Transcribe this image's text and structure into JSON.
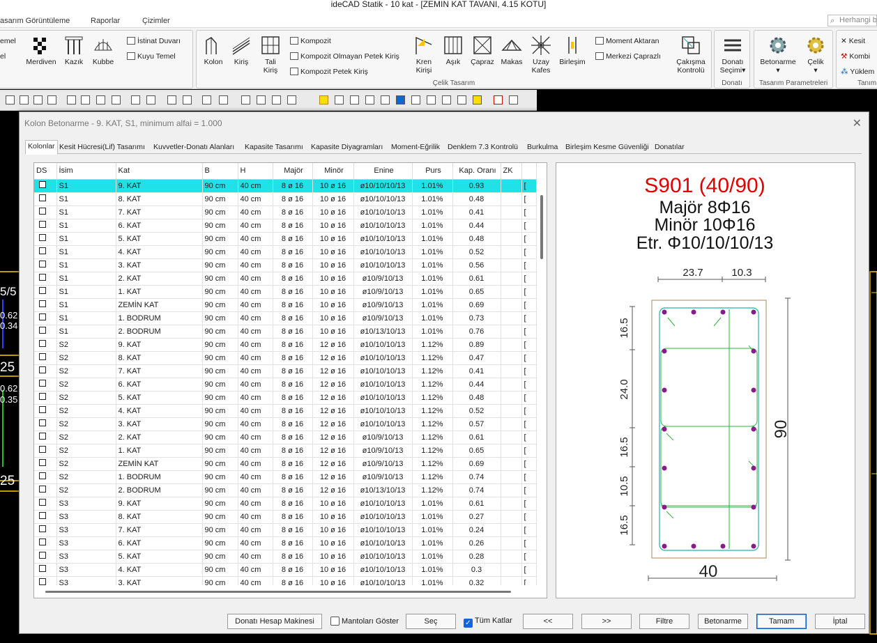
{
  "window_title": "ideCAD Statik - 10 kat - [ZEMIN KAT TAVANI,  4.15 KOTU]",
  "menu": [
    "asarım Görüntüleme",
    "Raporlar",
    "Çizimler"
  ],
  "search_placeholder": "Herhangi b",
  "ribbon": {
    "left_items": [
      "emel",
      "el"
    ],
    "merdiven": "Merdiven",
    "kazik": "Kazık",
    "kubbe": "Kubbe",
    "istinat": "İstinat Duvarı",
    "kuyu": "Kuyu Temel",
    "kolon": "Kolon",
    "kiris": "Kiriş",
    "tali1": "Tali",
    "tali2": "Kiriş",
    "kompozit": "Kompozit",
    "kompozit_olmayan": "Kompozit Olmayan Petek Kiriş",
    "kompozit_petek": "Kompozit Petek Kiriş",
    "kren1": "Kren",
    "kren2": "Kirişi",
    "asik": "Aşık",
    "capraz": "Çapraz",
    "makas": "Makas",
    "uzay1": "Uzay",
    "uzay2": "Kafes",
    "birlesim": "Birleşim",
    "moment": "Moment Aktaran",
    "merkezi": "Merkezi Çaprazlı",
    "cakisma1": "Çakışma",
    "cakisma2": "Kontrolü",
    "celik_tasarim": "Çelik Tasarım",
    "donati_sec1": "Donatı",
    "donati_sec2": "Seçimi",
    "donati": "Donatı",
    "betonarme": "Betonarme",
    "celik": "Çelik",
    "tasarim_param": "Tasarım Parametreleri",
    "kesit": "Kesit",
    "kombi": "Kombi",
    "yuklem": "Yüklem",
    "tanim": "Tanım"
  },
  "dialog": {
    "title": "Kolon Betonarme - 9. KAT, S1, minimum alfai = 1.000",
    "tabs": [
      "Kolonlar",
      "Kesit Hücresi(Lif) Tasarımı",
      "Kuvvetler-Donatı Alanları",
      "Kapasite Tasarımı",
      "Kapasite Diyagramları",
      "Moment-Eğrilik",
      "Denklem 7.3 Kontrolü",
      "Burkulma",
      "Birleşim Kesme Güvenliği",
      "Donatılar"
    ],
    "columns": [
      "DS",
      "İsim",
      "Kat",
      "B",
      "H",
      "Majör",
      "Minör",
      "Enine",
      "Purs",
      "Kap. Oranı",
      "ZK"
    ],
    "rows": [
      [
        "S1",
        "9. KAT",
        "90 cm",
        "40 cm",
        "8 ø 16",
        "10 ø 16",
        "ø10/10/10/13",
        "1.01%",
        "0.93"
      ],
      [
        "S1",
        "8. KAT",
        "90 cm",
        "40 cm",
        "8 ø 16",
        "10 ø 16",
        "ø10/10/10/13",
        "1.01%",
        "0.48"
      ],
      [
        "S1",
        "7. KAT",
        "90 cm",
        "40 cm",
        "8 ø 16",
        "10 ø 16",
        "ø10/10/10/13",
        "1.01%",
        "0.41"
      ],
      [
        "S1",
        "6. KAT",
        "90 cm",
        "40 cm",
        "8 ø 16",
        "10 ø 16",
        "ø10/10/10/13",
        "1.01%",
        "0.44"
      ],
      [
        "S1",
        "5. KAT",
        "90 cm",
        "40 cm",
        "8 ø 16",
        "10 ø 16",
        "ø10/10/10/13",
        "1.01%",
        "0.48"
      ],
      [
        "S1",
        "4. KAT",
        "90 cm",
        "40 cm",
        "8 ø 16",
        "10 ø 16",
        "ø10/10/10/13",
        "1.01%",
        "0.52"
      ],
      [
        "S1",
        "3. KAT",
        "90 cm",
        "40 cm",
        "8 ø 16",
        "10 ø 16",
        "ø10/10/10/13",
        "1.01%",
        "0.56"
      ],
      [
        "S1",
        "2. KAT",
        "90 cm",
        "40 cm",
        "8 ø 16",
        "10 ø 16",
        "ø10/9/10/13",
        "1.01%",
        "0.61"
      ],
      [
        "S1",
        "1. KAT",
        "90 cm",
        "40 cm",
        "8 ø 16",
        "10 ø 16",
        "ø10/9/10/13",
        "1.01%",
        "0.65"
      ],
      [
        "S1",
        "ZEMİN KAT",
        "90 cm",
        "40 cm",
        "8 ø 16",
        "10 ø 16",
        "ø10/9/10/13",
        "1.01%",
        "0.69"
      ],
      [
        "S1",
        "1. BODRUM",
        "90 cm",
        "40 cm",
        "8 ø 16",
        "10 ø 16",
        "ø10/9/10/13",
        "1.01%",
        "0.73"
      ],
      [
        "S1",
        "2. BODRUM",
        "90 cm",
        "40 cm",
        "8 ø 16",
        "10 ø 16",
        "ø10/13/10/13",
        "1.01%",
        "0.76"
      ],
      [
        "S2",
        "9. KAT",
        "90 cm",
        "40 cm",
        "8 ø 16",
        "12 ø 16",
        "ø10/10/10/13",
        "1.12%",
        "0.89"
      ],
      [
        "S2",
        "8. KAT",
        "90 cm",
        "40 cm",
        "8 ø 16",
        "12 ø 16",
        "ø10/10/10/13",
        "1.12%",
        "0.47"
      ],
      [
        "S2",
        "7. KAT",
        "90 cm",
        "40 cm",
        "8 ø 16",
        "12 ø 16",
        "ø10/10/10/13",
        "1.12%",
        "0.41"
      ],
      [
        "S2",
        "6. KAT",
        "90 cm",
        "40 cm",
        "8 ø 16",
        "12 ø 16",
        "ø10/10/10/13",
        "1.12%",
        "0.44"
      ],
      [
        "S2",
        "5. KAT",
        "90 cm",
        "40 cm",
        "8 ø 16",
        "12 ø 16",
        "ø10/10/10/13",
        "1.12%",
        "0.48"
      ],
      [
        "S2",
        "4. KAT",
        "90 cm",
        "40 cm",
        "8 ø 16",
        "12 ø 16",
        "ø10/10/10/13",
        "1.12%",
        "0.52"
      ],
      [
        "S2",
        "3. KAT",
        "90 cm",
        "40 cm",
        "8 ø 16",
        "12 ø 16",
        "ø10/10/10/13",
        "1.12%",
        "0.57"
      ],
      [
        "S2",
        "2. KAT",
        "90 cm",
        "40 cm",
        "8 ø 16",
        "12 ø 16",
        "ø10/9/10/13",
        "1.12%",
        "0.61"
      ],
      [
        "S2",
        "1. KAT",
        "90 cm",
        "40 cm",
        "8 ø 16",
        "12 ø 16",
        "ø10/9/10/13",
        "1.12%",
        "0.65"
      ],
      [
        "S2",
        "ZEMİN KAT",
        "90 cm",
        "40 cm",
        "8 ø 16",
        "12 ø 16",
        "ø10/9/10/13",
        "1.12%",
        "0.69"
      ],
      [
        "S2",
        "1. BODRUM",
        "90 cm",
        "40 cm",
        "8 ø 16",
        "12 ø 16",
        "ø10/9/10/13",
        "1.12%",
        "0.74"
      ],
      [
        "S2",
        "2. BODRUM",
        "90 cm",
        "40 cm",
        "8 ø 16",
        "12 ø 16",
        "ø10/13/10/13",
        "1.12%",
        "0.74"
      ],
      [
        "S3",
        "9. KAT",
        "90 cm",
        "40 cm",
        "8 ø 16",
        "10 ø 16",
        "ø10/10/10/13",
        "1.01%",
        "0.61"
      ],
      [
        "S3",
        "8. KAT",
        "90 cm",
        "40 cm",
        "8 ø 16",
        "10 ø 16",
        "ø10/10/10/13",
        "1.01%",
        "0.27"
      ],
      [
        "S3",
        "7. KAT",
        "90 cm",
        "40 cm",
        "8 ø 16",
        "10 ø 16",
        "ø10/10/10/13",
        "1.01%",
        "0.24"
      ],
      [
        "S3",
        "6. KAT",
        "90 cm",
        "40 cm",
        "8 ø 16",
        "10 ø 16",
        "ø10/10/10/13",
        "1.01%",
        "0.26"
      ],
      [
        "S3",
        "5. KAT",
        "90 cm",
        "40 cm",
        "8 ø 16",
        "10 ø 16",
        "ø10/10/10/13",
        "1.01%",
        "0.28"
      ],
      [
        "S3",
        "4. KAT",
        "90 cm",
        "40 cm",
        "8 ø 16",
        "10 ø 16",
        "ø10/10/10/13",
        "1.01%",
        "0.3"
      ],
      [
        "S3",
        "3. KAT",
        "90 cm",
        "40 cm",
        "8 ø 16",
        "10 ø 16",
        "ø10/10/10/13",
        "1.01%",
        "0.32"
      ]
    ],
    "selected_row": 0,
    "section": {
      "title": "S901 (40/90)",
      "major": "Majör 8Φ16",
      "minor": "Minör 10Φ16",
      "stirrup": "Etr. Φ10/10/10/13",
      "dim_top1": "23.7",
      "dim_top2": "10.3",
      "dim_side": [
        "16.5",
        "24.0",
        "16.5",
        "10.5",
        "16.5"
      ],
      "dim_height": "90",
      "dim_width": "40"
    },
    "buttons": {
      "hesap": "Donatı Hesap Makinesi",
      "mantolar": "Mantoları Göster",
      "sec": "Seç",
      "tum_katlar": "Tüm Katlar",
      "prev": "<<",
      "next": ">>",
      "filtre": "Filtre",
      "betonarme": "Betonarme",
      "tamam": "Tamam",
      "iptal": "İptal"
    },
    "tum_katlar_checked": true,
    "mantolar_checked": false
  }
}
